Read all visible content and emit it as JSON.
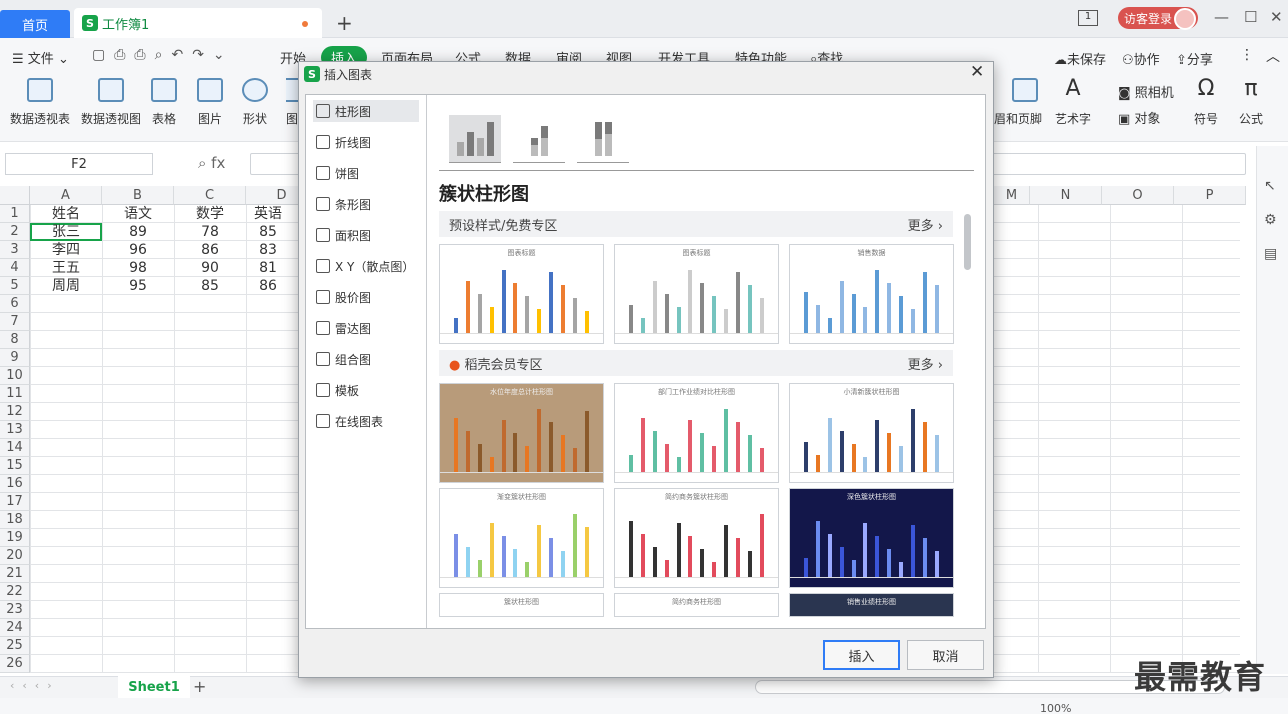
{
  "tabs": {
    "home": "首页",
    "doc": "工作簿1",
    "new_tab": "+"
  },
  "account": {
    "login": "访客登录",
    "window_counter": "1"
  },
  "menu": {
    "file": "文件",
    "items": [
      "开始",
      "插入",
      "页面布局",
      "公式",
      "数据",
      "审阅",
      "视图",
      "开发工具",
      "特色功能",
      "查找"
    ],
    "right": [
      "未保存",
      "协作",
      "分享"
    ]
  },
  "ribbon": {
    "left": [
      "数据透视表",
      "数据透视图",
      "表格",
      "图片",
      "形状",
      "图"
    ],
    "right": [
      "眉和页脚",
      "艺术字",
      "照相机",
      "对象",
      "符号",
      "公式"
    ]
  },
  "formula": {
    "name_box": "F2",
    "fx": "fx"
  },
  "columns": [
    "A",
    "B",
    "C",
    "D",
    "M",
    "N",
    "O",
    "P"
  ],
  "rows": [
    "1",
    "2",
    "3",
    "4",
    "5",
    "6",
    "7",
    "8",
    "9",
    "10",
    "11",
    "12",
    "13",
    "14",
    "15",
    "16",
    "17",
    "18",
    "19",
    "20",
    "21",
    "22",
    "23",
    "24",
    "25",
    "26"
  ],
  "cells": [
    [
      "姓名",
      "语文",
      "数学",
      "英语"
    ],
    [
      "张三",
      "89",
      "78",
      "85"
    ],
    [
      "李四",
      "96",
      "86",
      "83"
    ],
    [
      "王五",
      "98",
      "90",
      "81"
    ],
    [
      "周周",
      "95",
      "85",
      "86"
    ]
  ],
  "sheet": {
    "tab": "Sheet1",
    "zoom": "100%"
  },
  "dialog": {
    "title": "插入图表",
    "categories": [
      "柱形图",
      "折线图",
      "饼图",
      "条形图",
      "面积图",
      "X Y（散点图）",
      "股价图",
      "雷达图",
      "组合图",
      "模板",
      "在线图表"
    ],
    "selected_category": "柱形图",
    "subtype_title": "簇状柱形图",
    "section1": "预设样式/免费专区",
    "section2": "稻壳会员专区",
    "more": "更多 ›",
    "card_titles": [
      "图表标题",
      "图表标题",
      "销售数据",
      "水位年度总计柱形图",
      "部门工作业绩对比柱形图",
      "小清新簇状柱形图",
      "渐变簇状柱形图",
      "简约商务簇状柱形图",
      "深色簇状柱形图",
      "簇状柱形图",
      "简约商务柱形图",
      "销售业绩柱形图"
    ],
    "insert_btn": "插入",
    "cancel_btn": "取消"
  },
  "watermark": "最需教育",
  "colors": {
    "accent": "#17a34a",
    "primary": "#2f7cf6"
  }
}
